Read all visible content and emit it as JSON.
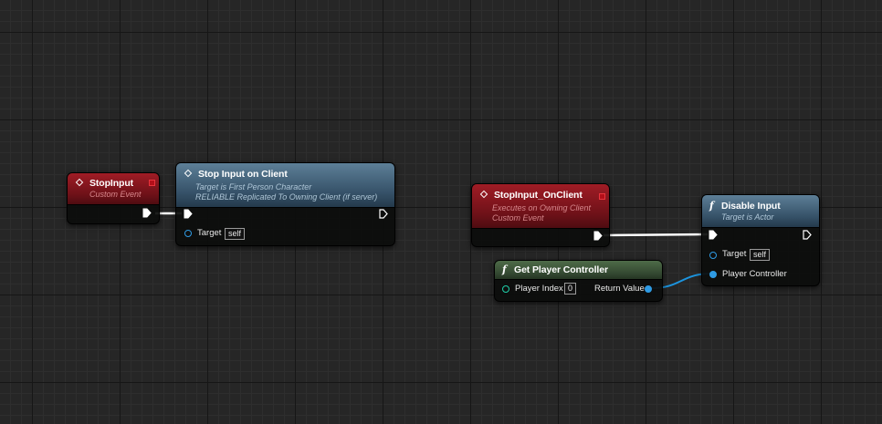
{
  "colors": {
    "exec_wire": "#ffffff",
    "object_wire": "#1c94de",
    "event_header": "#7a1219",
    "function_header": "#3b566c",
    "pure_function_header": "#3a5236"
  },
  "nodes": {
    "stop_input_event": {
      "title": "StopInput",
      "subtitle": "Custom Event",
      "icon": "event-diamond-icon"
    },
    "stop_input_on_client": {
      "title": "Stop Input on Client",
      "subtitle_1": "Target is First Person Character",
      "subtitle_2": "RELIABLE Replicated To Owning Client (if server)",
      "icon": "event-diamond-icon",
      "target_label": "Target",
      "target_value": "self"
    },
    "stop_input_onclient_event": {
      "title": "StopInput_OnClient",
      "subtitle_1": "Executes on Owning Client",
      "subtitle_2": "Custom Event",
      "icon": "event-diamond-icon"
    },
    "disable_input": {
      "title": "Disable Input",
      "subtitle": "Target is Actor",
      "icon": "function-icon",
      "target_label": "Target",
      "target_value": "self",
      "player_controller_label": "Player Controller"
    },
    "get_player_controller": {
      "title": "Get Player Controller",
      "icon": "function-icon",
      "player_index_label": "Player Index",
      "player_index_value": "0",
      "return_value_label": "Return Value"
    }
  }
}
